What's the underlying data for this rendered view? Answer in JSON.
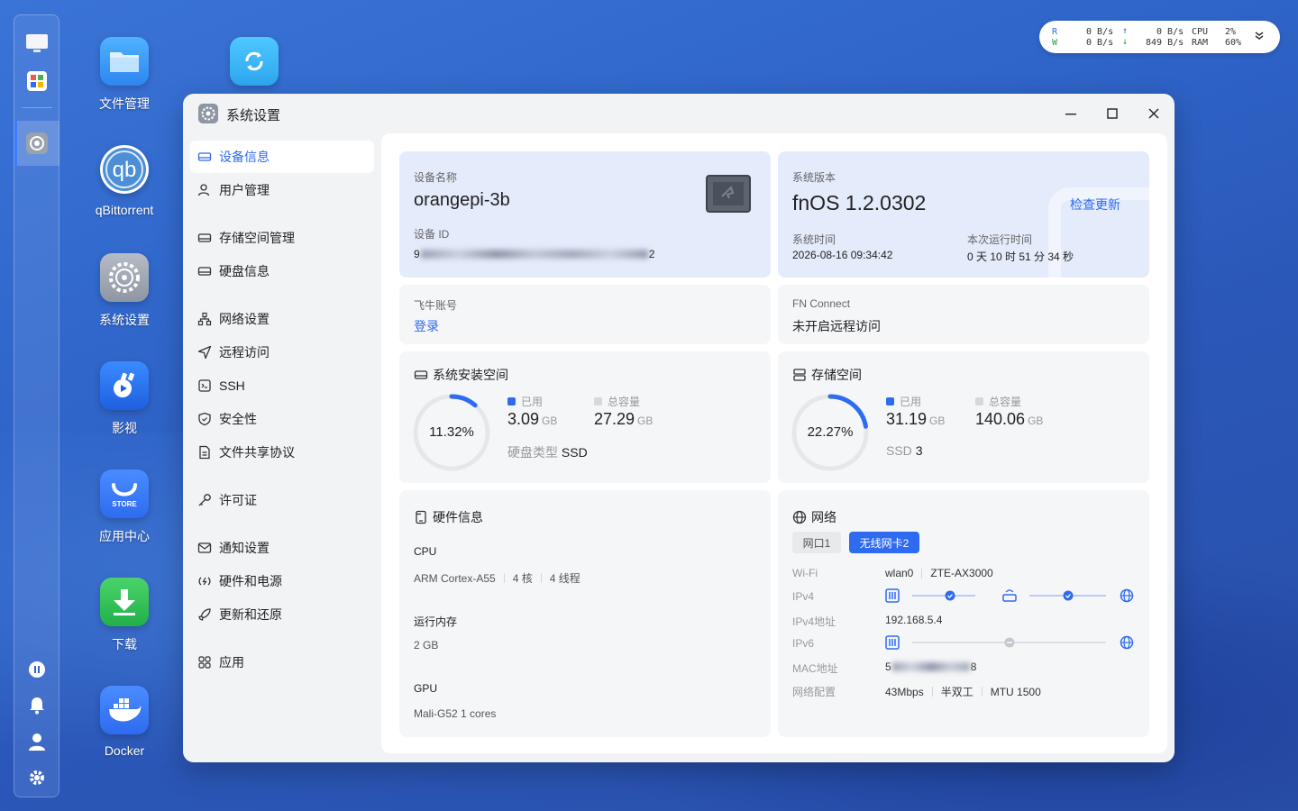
{
  "desktop": {
    "icons": [
      {
        "label": "文件管理"
      },
      {
        "label": ""
      },
      {
        "label": "qBittorrent"
      },
      {
        "label": "系统设置"
      },
      {
        "label": "影视"
      },
      {
        "label": "应用中心"
      },
      {
        "label": "下载"
      },
      {
        "label": "Docker"
      }
    ]
  },
  "netmon": {
    "r_label": "R",
    "w_label": "W",
    "r_rate1": "0 B/s",
    "w_rate1": "0 B/s",
    "r_rate2": "0 B/s",
    "w_rate2": "849 B/s",
    "cpu_label": "CPU",
    "ram_label": "RAM",
    "cpu_val": "2%",
    "ram_val": "60%"
  },
  "window": {
    "title": "系统设置",
    "minimize_icon": "minimize-icon",
    "maximize_icon": "maximize-icon",
    "close_icon": "close-icon"
  },
  "sidebar": {
    "items": [
      {
        "label": "设备信息",
        "icon": "device-icon"
      },
      {
        "label": "用户管理",
        "icon": "user-icon"
      },
      {
        "label": "存储空间管理",
        "icon": "storage-icon"
      },
      {
        "label": "硬盘信息",
        "icon": "disk-icon"
      },
      {
        "label": "网络设置",
        "icon": "network-icon"
      },
      {
        "label": "远程访问",
        "icon": "send-icon"
      },
      {
        "label": "SSH",
        "icon": "terminal-icon"
      },
      {
        "label": "安全性",
        "icon": "shield-icon"
      },
      {
        "label": "文件共享协议",
        "icon": "file-icon"
      },
      {
        "label": "许可证",
        "icon": "key-icon"
      },
      {
        "label": "通知设置",
        "icon": "mail-icon"
      },
      {
        "label": "硬件和电源",
        "icon": "power-icon"
      },
      {
        "label": "更新和还原",
        "icon": "rocket-icon"
      },
      {
        "label": "应用",
        "icon": "apps-icon"
      }
    ]
  },
  "device": {
    "name_label": "设备名称",
    "name": "orangepi-3b",
    "id_label": "设备 ID",
    "id_prefix": "9",
    "id_suffix": "2"
  },
  "system": {
    "version_label": "系统版本",
    "version": "fnOS  1.2.0302",
    "check_update": "检查更新",
    "time_label": "系统时间",
    "time": "2026-08-16 09:34:42",
    "uptime_label": "本次运行时间",
    "uptime": "0 天 10 时 51 分 34 秒"
  },
  "account": {
    "label": "飞牛账号",
    "login": "登录"
  },
  "fnconnect": {
    "label": "FN Connect",
    "status": "未开启远程访问"
  },
  "sys_space": {
    "title": "系统安装空间",
    "percent": "11.32%",
    "percent_value": 11.32,
    "used_label": "已用",
    "total_label": "总容量",
    "used": "3.09",
    "total": "27.29",
    "unit": "GB",
    "disk_type_label": "硬盘类型",
    "disk_type": "SSD"
  },
  "storage": {
    "title": "存储空间",
    "percent": "22.27%",
    "percent_value": 22.27,
    "used_label": "已用",
    "total_label": "总容量",
    "used": "31.19",
    "total": "140.06",
    "unit": "GB",
    "ssd_label": "SSD",
    "ssd_count": "3"
  },
  "hardware": {
    "title": "硬件信息",
    "cpu_label": "CPU",
    "cpu_model": "ARM Cortex-A55",
    "cpu_cores": "4 核",
    "cpu_threads": "4 线程",
    "ram_label": "运行内存",
    "ram": "2 GB",
    "gpu_label": "GPU",
    "gpu": "Mali-G52 1 cores"
  },
  "network": {
    "title": "网络",
    "tabs": [
      {
        "label": "网口1",
        "active": false
      },
      {
        "label": "无线网卡2",
        "active": true
      }
    ],
    "wifi_label": "Wi-Fi",
    "wifi_iface": "wlan0",
    "wifi_ssid": "ZTE-AX3000",
    "ipv4_label": "IPv4",
    "ipv4addr_label": "IPv4地址",
    "ipv4addr": "192.168.5.4",
    "ipv6_label": "IPv6",
    "mac_label": "MAC地址",
    "mac_prefix": "5",
    "mac_suffix": "8",
    "config_label": "网络配置",
    "speed": "43Mbps",
    "duplex": "半双工",
    "mtu": "MTU 1500"
  },
  "colors": {
    "accent": "#2e6bf0",
    "ring_track": "#e6e7ea"
  }
}
